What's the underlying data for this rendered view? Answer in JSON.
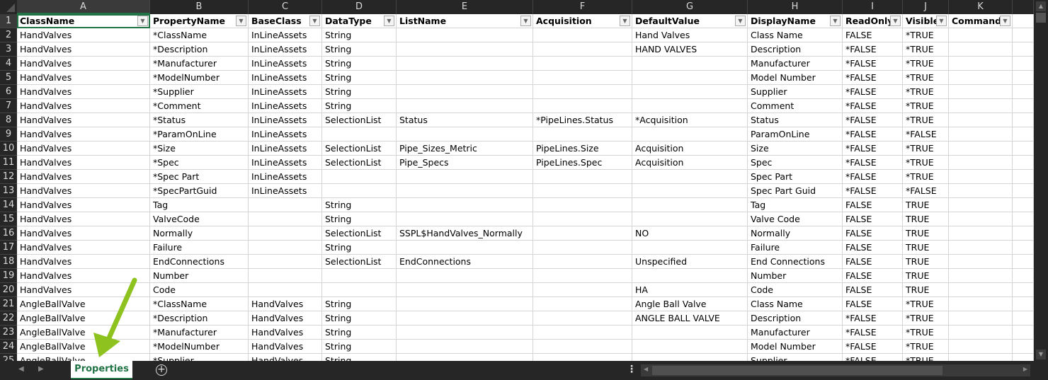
{
  "columns": [
    {
      "letter": "A",
      "header": "ClassName"
    },
    {
      "letter": "B",
      "header": "PropertyName"
    },
    {
      "letter": "C",
      "header": "BaseClass"
    },
    {
      "letter": "D",
      "header": "DataType"
    },
    {
      "letter": "E",
      "header": "ListName"
    },
    {
      "letter": "F",
      "header": "Acquisition"
    },
    {
      "letter": "G",
      "header": "DefaultValue"
    },
    {
      "letter": "H",
      "header": "DisplayName"
    },
    {
      "letter": "I",
      "header": "ReadOnly"
    },
    {
      "letter": "J",
      "header": "Visible"
    },
    {
      "letter": "K",
      "header": "Command"
    }
  ],
  "rows": [
    [
      "HandValves",
      "*ClassName",
      "InLineAssets",
      "String",
      "",
      "",
      "Hand Valves",
      "Class Name",
      "FALSE",
      "*TRUE",
      ""
    ],
    [
      "HandValves",
      "*Description",
      "InLineAssets",
      "String",
      "",
      "",
      "HAND VALVES",
      "Description",
      "*FALSE",
      "*TRUE",
      ""
    ],
    [
      "HandValves",
      "*Manufacturer",
      "InLineAssets",
      "String",
      "",
      "",
      "",
      "Manufacturer",
      "*FALSE",
      "*TRUE",
      ""
    ],
    [
      "HandValves",
      "*ModelNumber",
      "InLineAssets",
      "String",
      "",
      "",
      "",
      "Model Number",
      "*FALSE",
      "*TRUE",
      ""
    ],
    [
      "HandValves",
      "*Supplier",
      "InLineAssets",
      "String",
      "",
      "",
      "",
      "Supplier",
      "*FALSE",
      "*TRUE",
      ""
    ],
    [
      "HandValves",
      "*Comment",
      "InLineAssets",
      "String",
      "",
      "",
      "",
      "Comment",
      "*FALSE",
      "*TRUE",
      ""
    ],
    [
      "HandValves",
      "*Status",
      "InLineAssets",
      "SelectionList",
      "Status",
      "*PipeLines.Status",
      "*Acquisition",
      "Status",
      "*FALSE",
      "*TRUE",
      ""
    ],
    [
      "HandValves",
      "*ParamOnLine",
      "InLineAssets",
      "",
      "",
      "",
      "",
      "ParamOnLine",
      "*FALSE",
      "*FALSE",
      ""
    ],
    [
      "HandValves",
      "*Size",
      "InLineAssets",
      "SelectionList",
      "Pipe_Sizes_Metric",
      "PipeLines.Size",
      "Acquisition",
      "Size",
      "*FALSE",
      "*TRUE",
      ""
    ],
    [
      "HandValves",
      "*Spec",
      "InLineAssets",
      "SelectionList",
      "Pipe_Specs",
      "PipeLines.Spec",
      "Acquisition",
      "Spec",
      "*FALSE",
      "*TRUE",
      ""
    ],
    [
      "HandValves",
      "*Spec Part",
      "InLineAssets",
      "",
      "",
      "",
      "",
      "Spec Part",
      "*FALSE",
      "*TRUE",
      ""
    ],
    [
      "HandValves",
      "*SpecPartGuid",
      "InLineAssets",
      "",
      "",
      "",
      "",
      "Spec Part Guid",
      "*FALSE",
      "*FALSE",
      ""
    ],
    [
      "HandValves",
      "Tag",
      "",
      "String",
      "",
      "",
      "",
      "Tag",
      "FALSE",
      "TRUE",
      ""
    ],
    [
      "HandValves",
      "ValveCode",
      "",
      "String",
      "",
      "",
      "",
      "Valve Code",
      "FALSE",
      "TRUE",
      ""
    ],
    [
      "HandValves",
      "Normally",
      "",
      "SelectionList",
      "SSPL$HandValves_Normally",
      "",
      "NO",
      "Normally",
      "FALSE",
      "TRUE",
      ""
    ],
    [
      "HandValves",
      "Failure",
      "",
      "String",
      "",
      "",
      "",
      "Failure",
      "FALSE",
      "TRUE",
      ""
    ],
    [
      "HandValves",
      "EndConnections",
      "",
      "SelectionList",
      "EndConnections",
      "",
      "Unspecified",
      "End Connections",
      "FALSE",
      "TRUE",
      ""
    ],
    [
      "HandValves",
      "Number",
      "",
      "",
      "",
      "",
      "",
      "Number",
      "FALSE",
      "TRUE",
      ""
    ],
    [
      "HandValves",
      "Code",
      "",
      "",
      "",
      "",
      "HA",
      "Code",
      "FALSE",
      "TRUE",
      ""
    ],
    [
      "AngleBallValve",
      "*ClassName",
      "HandValves",
      "String",
      "",
      "",
      "Angle Ball Valve",
      "Class Name",
      "FALSE",
      "*TRUE",
      ""
    ],
    [
      "AngleBallValve",
      "*Description",
      "HandValves",
      "String",
      "",
      "",
      "ANGLE BALL VALVE",
      "Description",
      "*FALSE",
      "*TRUE",
      ""
    ],
    [
      "AngleBallValve",
      "*Manufacturer",
      "HandValves",
      "String",
      "",
      "",
      "",
      "Manufacturer",
      "*FALSE",
      "*TRUE",
      ""
    ],
    [
      "AngleBallValve",
      "*ModelNumber",
      "HandValves",
      "String",
      "",
      "",
      "",
      "Model Number",
      "*FALSE",
      "*TRUE",
      ""
    ],
    [
      "AngleBallValve",
      "*Supplier",
      "HandValves",
      "String",
      "",
      "",
      "",
      "Supplier",
      "*FALSE",
      "*TRUE",
      ""
    ]
  ],
  "sheet_tab": "Properties",
  "icons": {
    "add_sheet": "plus-circle-icon",
    "filter": "dropdown-arrow-icon",
    "annotation": "green-arrow"
  },
  "colors": {
    "accent": "#217346",
    "arrow": "#8dc21f"
  }
}
